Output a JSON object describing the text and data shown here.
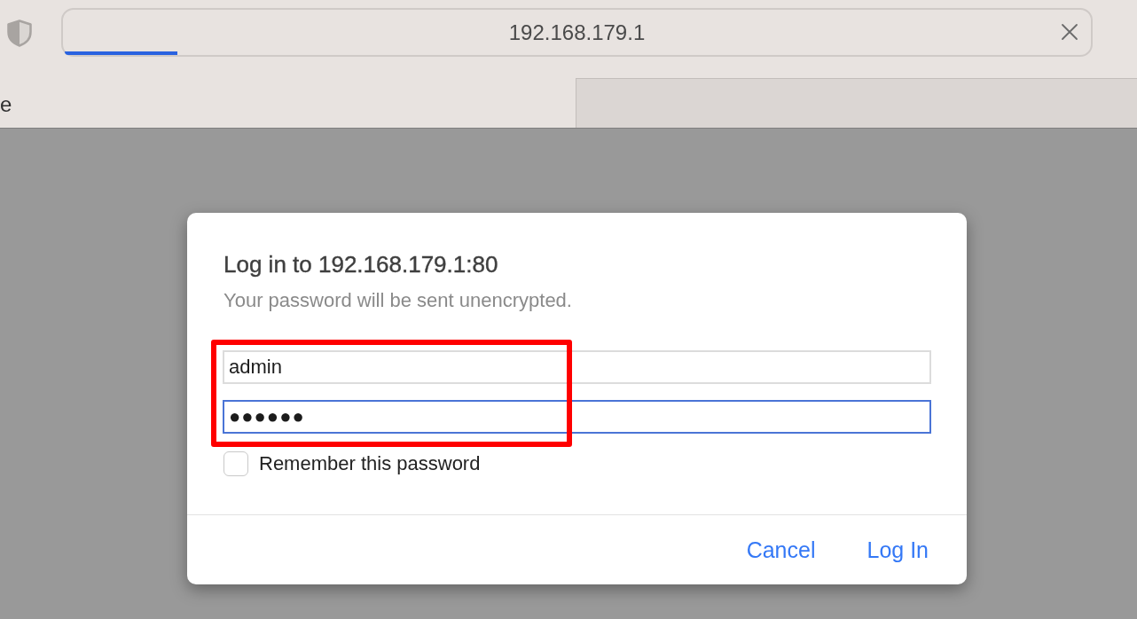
{
  "browser": {
    "address_bar": {
      "url": "192.168.179.1",
      "progress": {
        "level": 0.11
      }
    },
    "tabs": [
      {
        "label": "e",
        "selected": true
      }
    ]
  },
  "dialog": {
    "title": "Log in to 192.168.179.1:80",
    "subtitle": "Your password will be sent unencrypted.",
    "fields": [
      {
        "kind": "text",
        "value": "admin",
        "focused": false
      },
      {
        "kind": "password",
        "value": "●●●●●●",
        "focused": true
      }
    ],
    "remember": {
      "label": "Remember this password",
      "checked": false
    },
    "buttons": [
      {
        "label": "Cancel"
      },
      {
        "label": "Log In"
      }
    ],
    "annotation": {
      "kind": "rectangle"
    }
  }
}
